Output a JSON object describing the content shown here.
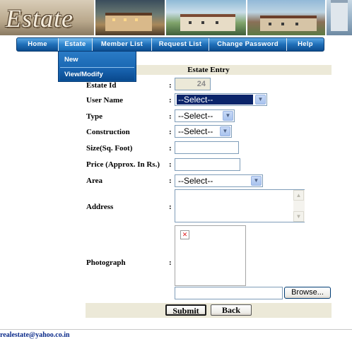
{
  "banner": {
    "logo_text": "Estate"
  },
  "nav": {
    "items": [
      {
        "label": "Home"
      },
      {
        "label": "Estate"
      },
      {
        "label": "Member List"
      },
      {
        "label": "Request List"
      },
      {
        "label": "Change Password"
      },
      {
        "label": "Help"
      }
    ],
    "dropdown": [
      {
        "label": "New"
      },
      {
        "label": "View/Modify"
      }
    ]
  },
  "form": {
    "title": "Estate Entry",
    "fields": {
      "estate_id": {
        "label": "Estate Id",
        "value": "24"
      },
      "user_name": {
        "label": "User Name",
        "value": "--Select--"
      },
      "type": {
        "label": "Type",
        "value": "--Select--"
      },
      "construction": {
        "label": "Construction",
        "value": "--Select--"
      },
      "size": {
        "label": "Size(Sq. Foot)",
        "value": ""
      },
      "price": {
        "label": "Price (Approx. In Rs.)",
        "value": ""
      },
      "area": {
        "label": "Area",
        "value": "--Select--"
      },
      "address": {
        "label": "Address",
        "value": ""
      },
      "photograph": {
        "label": "Photograph",
        "value": ""
      }
    },
    "colon": ":",
    "browse_label": "Browse...",
    "submit_label": "Submit",
    "back_label": "Back"
  },
  "footer": {
    "email": "realestate@yahoo.co.in"
  }
}
